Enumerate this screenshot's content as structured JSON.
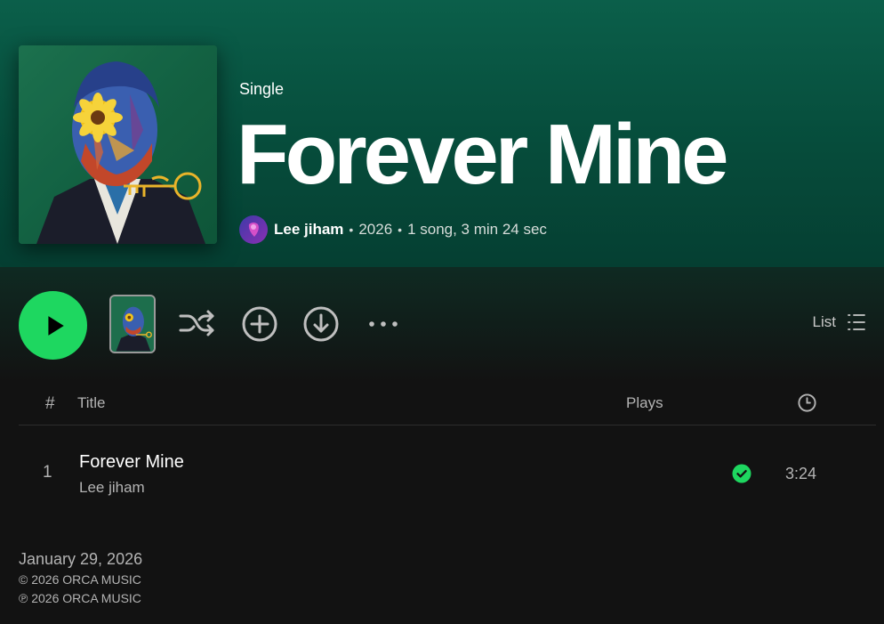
{
  "colors": {
    "accent": "#1ed760",
    "header_bg": "#0b5f4a",
    "page_bg": "#121212",
    "muted_text": "#b3b3b3"
  },
  "album": {
    "type": "Single",
    "title": "Forever Mine",
    "artist": "Lee jiham",
    "separator": "•",
    "year": "2026",
    "summary": "1 song, 3 min 24 sec",
    "cover_icon": "album-cover-art"
  },
  "actions": {
    "play_icon": "play-icon",
    "shuffle_icon": "shuffle-icon",
    "add_icon": "add-circle-icon",
    "download_icon": "download-icon",
    "more_icon": "more-options-icon",
    "view_label": "List",
    "view_icon": "list-view-icon"
  },
  "table": {
    "headers": {
      "number": "#",
      "title": "Title",
      "plays": "Plays",
      "duration_icon": "clock-icon"
    },
    "rows": [
      {
        "number": "1",
        "title": "Forever Mine",
        "artist": "Lee jiham",
        "plays": "",
        "saved_icon": "check-circle-icon",
        "duration": "3:24"
      }
    ]
  },
  "footer": {
    "release_date": "January 29, 2026",
    "copyright": "© 2026 ORCA MUSIC",
    "phonogram": "℗ 2026 ORCA MUSIC"
  }
}
